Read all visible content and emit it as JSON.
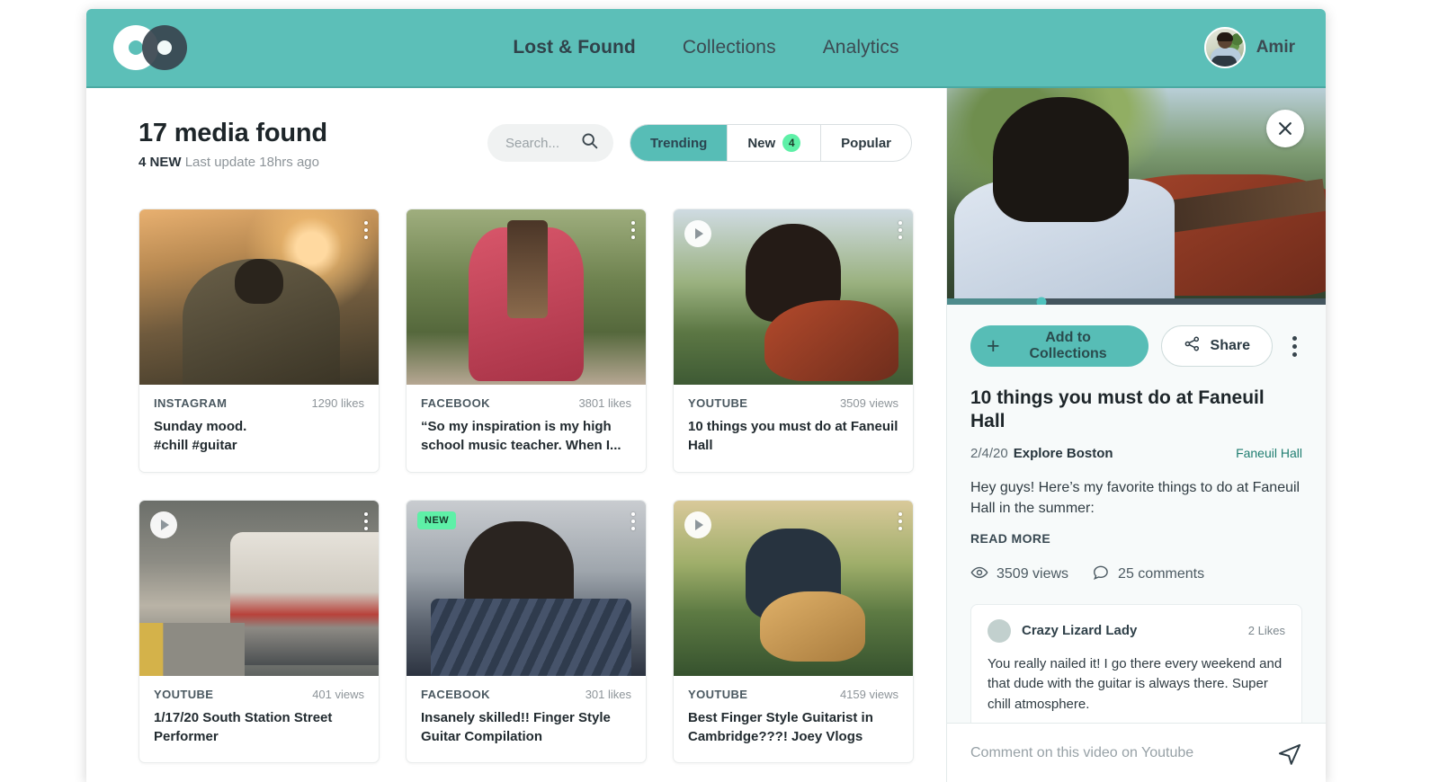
{
  "header": {
    "logo_name": "overlapping-circles-logo",
    "nav": [
      {
        "label": "Lost & Found",
        "active": true
      },
      {
        "label": "Collections",
        "active": false
      },
      {
        "label": "Analytics",
        "active": false
      }
    ],
    "user": {
      "name": "Amir"
    },
    "bg_color": "#5cbfb8"
  },
  "results": {
    "title": "17 media found",
    "new_count": "4 NEW",
    "last_update": "Last update 18hrs ago",
    "search": {
      "placeholder": "Search...",
      "value": ""
    },
    "filters": [
      {
        "label": "Trending",
        "active": true,
        "badge": ""
      },
      {
        "label": "New",
        "active": false,
        "badge": "4"
      },
      {
        "label": "Popular",
        "active": false,
        "badge": ""
      }
    ]
  },
  "cards": [
    {
      "source": "INSTAGRAM",
      "stat": "1290 likes",
      "caption": "Sunday mood.\n#chill #guitar",
      "has_play": false,
      "is_new": false
    },
    {
      "source": "FACEBOOK",
      "stat": "3801 likes",
      "caption": "“So my inspiration is my high school music teacher. When I...",
      "has_play": false,
      "is_new": false
    },
    {
      "source": "YOUTUBE",
      "stat": "3509 views",
      "caption": "10 things you must do at Faneuil Hall",
      "has_play": true,
      "is_new": false
    },
    {
      "source": "YOUTUBE",
      "stat": "401 views",
      "caption": "1/17/20 South Station Street Performer",
      "has_play": true,
      "is_new": false
    },
    {
      "source": "FACEBOOK",
      "stat": "301 likes",
      "caption": "Insanely skilled!! Finger Style Guitar Compilation",
      "has_play": false,
      "is_new": true,
      "new_label": "NEW"
    },
    {
      "source": "YOUTUBE",
      "stat": "4159 views",
      "caption": "Best Finger Style Guitarist in Cambridge???! Joey Vlogs",
      "has_play": true,
      "is_new": false
    }
  ],
  "detail": {
    "close_label": "close-icon",
    "progress_percent": 25,
    "add_button": "Add to Collections",
    "share_button": "Share",
    "title": "10 things you must do at Faneuil Hall",
    "date": "2/4/20",
    "author": "Explore Boston",
    "tag": "Faneuil Hall",
    "description": "Hey guys! Here’s my favorite things to do at Faneuil Hall in the summer:",
    "read_more": "READ MORE",
    "views": "3509 views",
    "comments": "25 comments",
    "comment": {
      "author": "Crazy Lizard Lady",
      "likes": "2 Likes",
      "body": "You really nailed it! I go there every weekend and that dude with the guitar is always there. Super chill atmosphere."
    },
    "comment_input": {
      "placeholder": "Comment on this video on Youtube",
      "value": ""
    }
  },
  "colors": {
    "accent_teal": "#57bdb6",
    "badge_green": "#5ef0a7",
    "tag_teal": "#1f7d70",
    "panel_bg": "#f7fafa"
  }
}
